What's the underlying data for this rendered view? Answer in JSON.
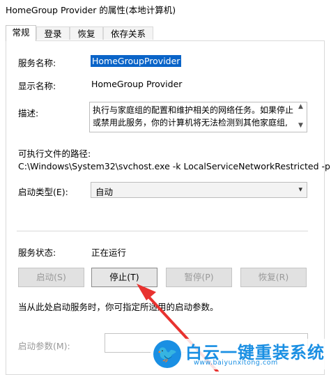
{
  "window": {
    "title": "HomeGroup Provider 的属性(本地计算机)"
  },
  "tabs": [
    {
      "label": "常规",
      "active": true
    },
    {
      "label": "登录",
      "active": false
    },
    {
      "label": "恢复",
      "active": false
    },
    {
      "label": "依存关系",
      "active": false
    }
  ],
  "general": {
    "service_name_label": "服务名称:",
    "service_name_value": "HomeGroupProvider",
    "display_name_label": "显示名称:",
    "display_name_value": "HomeGroup Provider",
    "description_label": "描述:",
    "description_value": "执行与家庭组的配置和维护相关的网络任务。如果停止或禁用此服务，你的计算机将无法检测到其他家庭组,",
    "exe_path_label": "可执行文件的路径:",
    "exe_path_value": "C:\\Windows\\System32\\svchost.exe -k LocalServiceNetworkRestricted -p",
    "startup_type_label": "启动类型(E):",
    "startup_type_value": "自动",
    "status_label": "服务状态:",
    "status_value": "正在运行",
    "buttons": {
      "start": "启动(S)",
      "stop": "停止(T)",
      "pause": "暂停(P)",
      "resume": "恢复(R)"
    },
    "hint": "当从此处启动服务时，你可指定所适用的启动参数。",
    "param_label": "启动参数(M):"
  },
  "watermark": {
    "brand": "白云一键重装系统",
    "url": "www.baiyunxitong.com"
  },
  "colors": {
    "selection": "#0a64c8",
    "arrow": "#e8322f",
    "watermark": "#1a8fe3"
  }
}
